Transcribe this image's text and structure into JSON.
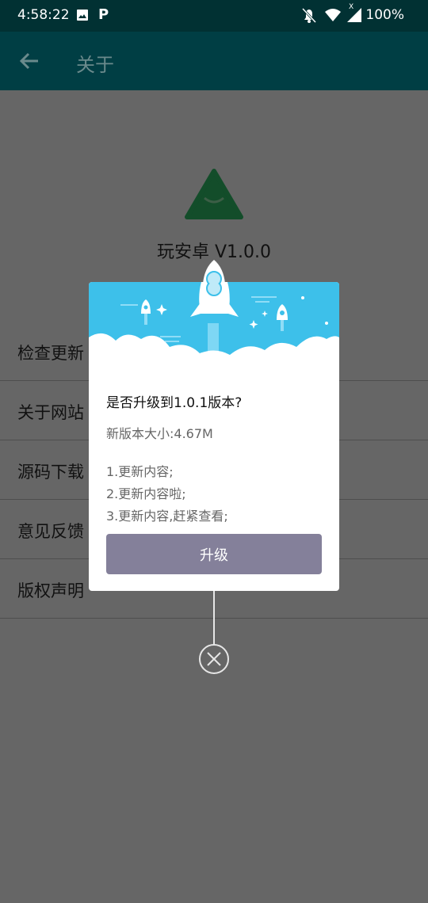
{
  "status_bar": {
    "time": "4:58:22",
    "p_label": "P",
    "x_label": "X",
    "battery": "100%"
  },
  "toolbar": {
    "title": "关于"
  },
  "about": {
    "app_name": "玩安卓 V1.0.0",
    "menu": [
      {
        "label": "检查更新"
      },
      {
        "label": "关于网站"
      },
      {
        "label": "源码下载"
      },
      {
        "label": "意见反馈"
      },
      {
        "label": "版权声明"
      }
    ]
  },
  "dialog": {
    "title": "是否升级到1.0.1版本?",
    "size_text": "新版本大小:4.67M",
    "changelog": [
      "1.更新内容;",
      "2.更新内容啦;",
      "3.更新内容,赶紧查看;"
    ],
    "upgrade_label": "升级"
  },
  "colors": {
    "status_bar_bg": "#013133",
    "toolbar_bg": "#003e44",
    "overlay_bg": "#666666",
    "button_bg": "#84809a",
    "hero_sky": "#3dc0ea"
  }
}
